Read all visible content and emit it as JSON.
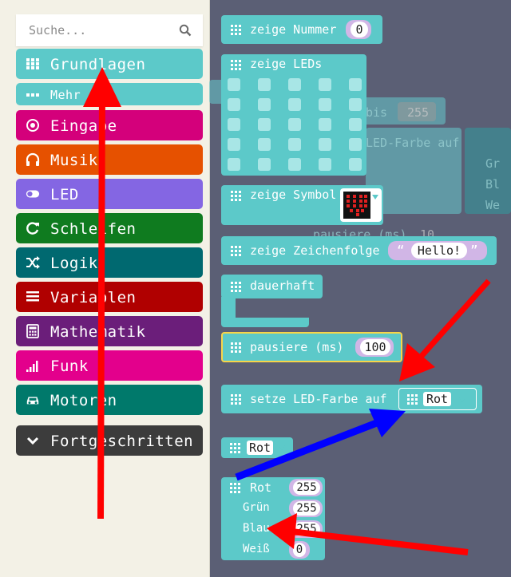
{
  "search": {
    "placeholder": "Suche...",
    "icon": "search-icon"
  },
  "categories": [
    {
      "label": "Grundlagen",
      "color": "#5cc9c9",
      "icon": "grid-icon"
    },
    {
      "label": "Mehr",
      "color": "#5cc9c9",
      "icon": "dots-icon"
    },
    {
      "label": "Eingabe",
      "color": "#d4007b",
      "icon": "target-icon"
    },
    {
      "label": "Musik",
      "color": "#e65100",
      "icon": "headphones-icon"
    },
    {
      "label": "LED",
      "color": "#8466e3",
      "icon": "toggle-icon"
    },
    {
      "label": "Schleifen",
      "color": "#0f7b1f",
      "icon": "refresh-icon"
    },
    {
      "label": "Logik",
      "color": "#006970",
      "icon": "shuffle-icon"
    },
    {
      "label": "Variablen",
      "color": "#b00000",
      "icon": "list-icon"
    },
    {
      "label": "Mathematik",
      "color": "#6b1e7a",
      "icon": "calculator-icon"
    },
    {
      "label": "Funk",
      "color": "#e3008c",
      "icon": "signal-icon"
    },
    {
      "label": "Motoren",
      "color": "#00796b",
      "icon": "car-icon"
    },
    {
      "label": "Fortgeschritten",
      "color": "#3c3c3c",
      "icon": "chevron-down-icon"
    }
  ],
  "blocks": {
    "show_number": {
      "label": "zeige Nummer",
      "value": "0"
    },
    "show_leds": {
      "label": "zeige LEDs"
    },
    "show_icon": {
      "label": "zeige Symbol"
    },
    "show_string": {
      "label": "zeige Zeichenfolge",
      "value": "Hello!"
    },
    "forever": {
      "label": "dauerhaft"
    },
    "pause": {
      "label": "pausiere (ms)",
      "value": "100"
    },
    "set_led_color": {
      "label": "setze LED-Farbe auf",
      "value": "Rot"
    },
    "color_dropdown": {
      "value": "Rot"
    },
    "rgb": {
      "rot_label": "Rot",
      "rot": "255",
      "gruen_label": "Grün",
      "gruen": "255",
      "blau_label": "Blau",
      "blau": "255",
      "weiss_label": "Weiß",
      "weiss": "0"
    }
  },
  "ghost": {
    "t1": "bis",
    "v1": "255",
    "t2": "LED-Farbe auf",
    "t3": "pausiere (ms)",
    "v3": "10",
    "t4": "Gr",
    "t5": "Bl",
    "t6": "We"
  },
  "colors": {
    "basic_teal": "#5cc9c9",
    "arrow_red": "#ff0000",
    "arrow_blue": "#0000ff"
  }
}
